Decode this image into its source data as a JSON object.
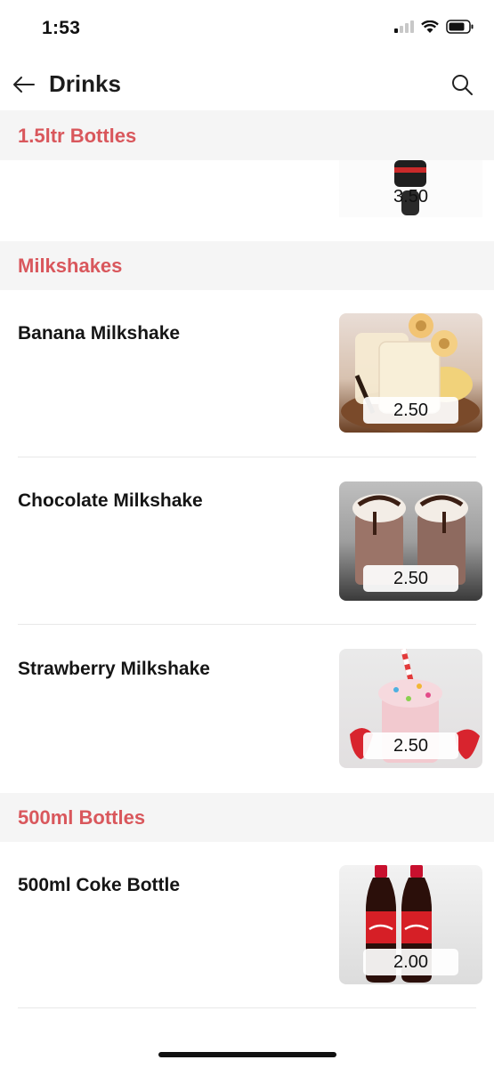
{
  "status": {
    "time": "1:53"
  },
  "nav": {
    "title": "Drinks"
  },
  "sections": [
    {
      "title": "1.5ltr Bottles",
      "items": [
        {
          "price": "3.50"
        }
      ]
    },
    {
      "title": "Milkshakes",
      "items": [
        {
          "name": "Banana Milkshake",
          "price": "2.50"
        },
        {
          "name": "Chocolate Milkshake",
          "price": "2.50"
        },
        {
          "name": "Strawberry Milkshake",
          "price": "2.50"
        }
      ]
    },
    {
      "title": "500ml Bottles",
      "items": [
        {
          "name": "500ml Coke Bottle",
          "price": "2.00"
        }
      ]
    }
  ],
  "colors": {
    "section_title": "#d9575c",
    "section_bg": "#f5f5f5"
  },
  "icons": [
    "back-arrow-icon",
    "search-icon",
    "signal-icon",
    "wifi-icon",
    "battery-icon"
  ]
}
